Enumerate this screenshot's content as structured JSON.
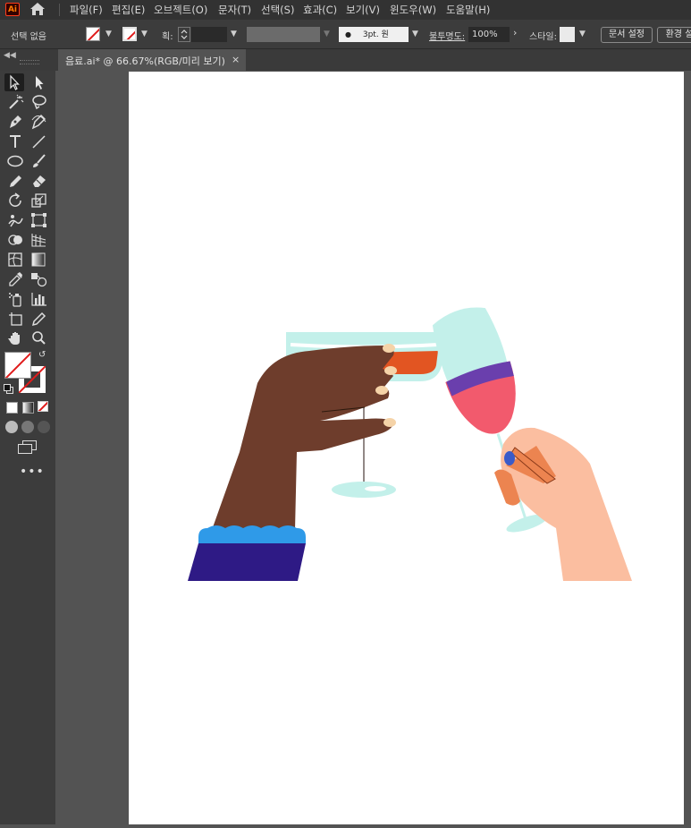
{
  "app": {
    "logo": "Ai",
    "home_icon": "home-icon"
  },
  "menu": [
    "파일(F)",
    "편집(E)",
    "오브젝트(O)",
    "문자(T)",
    "선택(S)",
    "효과(C)",
    "보기(V)",
    "윈도우(W)",
    "도움말(H)"
  ],
  "control": {
    "selection_status": "선택 없음",
    "stroke_label": "획:",
    "brush_value": "3pt. 원",
    "opacity_label": "불투명도:",
    "opacity_value": "100%",
    "style_label": "스타일:",
    "doc_setup": "문서 설정",
    "preferences": "환경 설"
  },
  "tab": {
    "title": "음료.ai* @ 66.67%(RGB/미리 보기)",
    "close": "×"
  },
  "tools": [
    "selection-tool",
    "direct-selection-tool",
    "magic-wand-tool",
    "lasso-tool",
    "pen-tool",
    "curvature-tool",
    "type-tool",
    "line-segment-tool",
    "ellipse-tool",
    "paintbrush-tool",
    "pencil-tool",
    "eraser-tool",
    "rotate-tool",
    "scale-tool",
    "puppet-warp-tool",
    "free-transform-tool",
    "shape-builder-tool",
    "perspective-grid-tool",
    "mesh-tool",
    "gradient-tool",
    "eyedropper-tool",
    "blend-tool",
    "symbol-sprayer-tool",
    "column-graph-tool",
    "artboard-tool",
    "slice-tool",
    "hand-tool",
    "zoom-tool"
  ],
  "colors": {
    "cup_glass": "#c3f0ea",
    "orange_drink": "#e25522",
    "red_wine": "#f25a6d",
    "purple_wine": "#6a3fad",
    "dark_skin": "#6e3d2c",
    "nails": "#f5d3a8",
    "cuff_blue": "#2f9ae8",
    "sleeve_navy": "#2e1a85",
    "light_skin": "#fbbea0",
    "finger_orange": "#ec8450",
    "nail_blue": "#3b5bc9"
  }
}
